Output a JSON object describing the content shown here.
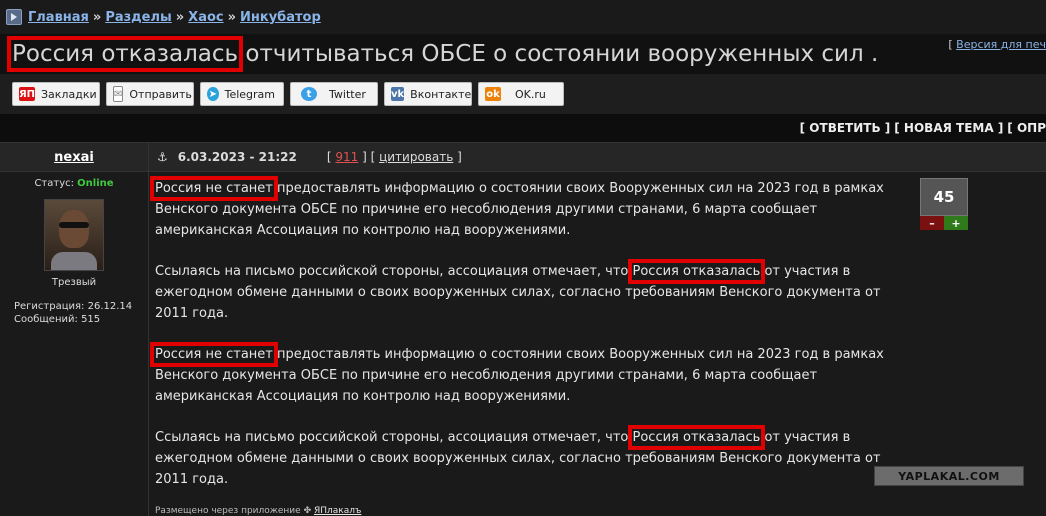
{
  "breadcrumb": {
    "items": [
      "Главная",
      "Разделы",
      "Хаос",
      "Инкубатор"
    ],
    "separator": "»"
  },
  "topic": {
    "title_highlight": "Россия отказалась",
    "title_rest": " отчитываться ОБСЕ о состоянии вооруженных сил .",
    "print_prefix": "[",
    "print_link": "Версия для печ"
  },
  "share": {
    "buttons": [
      {
        "label": "Закладки",
        "icon": "yaplakal-icon",
        "color": "#d11"
      },
      {
        "label": "Отправить",
        "icon": "mail-icon",
        "color": "#888"
      },
      {
        "label": "Telegram",
        "icon": "telegram-icon",
        "color": "#2aa3dd"
      },
      {
        "label": "Twitter",
        "icon": "twitter-icon",
        "color": "#3aa0e8"
      },
      {
        "label": "Вконтакте",
        "icon": "vk-icon",
        "color": "#4a76a8"
      },
      {
        "label": "OK.ru",
        "icon": "ok-icon",
        "color": "#ee8208"
      }
    ]
  },
  "actions": {
    "reply": "[ ОТВЕТИТЬ ]",
    "new_topic": "[ НОВАЯ ТЕМА ]",
    "more": "[ ОПР"
  },
  "post": {
    "author": "nexai",
    "date": "6.03.2023 - 21:22",
    "number": "911",
    "quote": "цитировать",
    "status_label": "Статус:",
    "status_value": "Online",
    "rank": "Трезвый",
    "reg_label": "Регистрация:",
    "reg_date": "26.12.14",
    "posts_label": "Сообщений:",
    "posts_count": "515",
    "rating": "45",
    "rating_minus": "–",
    "rating_plus": "+",
    "p1_hl": "Россия не станет",
    "p1_rest": " предоставлять информацию о состоянии своих Вооруженных сил на 2023 год в рамках Венского документа ОБСЕ по причине его несоблюдения другими странами, 6 марта сообщает американская Ассоциация по контролю над вооружениями.",
    "p2_pre": "Ссылаясь на письмо российской стороны, ассоциация отмечает, что ",
    "p2_hl": "Россия отказалась",
    "p2_rest": " от участия в ежегодном обмене данными о своих вооруженных силах, согласно требованиям Венского документа от 2011 года.",
    "sent_via": "Размещено через приложение",
    "app_name": "ЯПлакалъ"
  },
  "watermark": "YAPLAKAL.COM",
  "colors": {
    "link": "#8ab4e8",
    "highlight_box": "#e00000",
    "online": "#3fc93f"
  }
}
